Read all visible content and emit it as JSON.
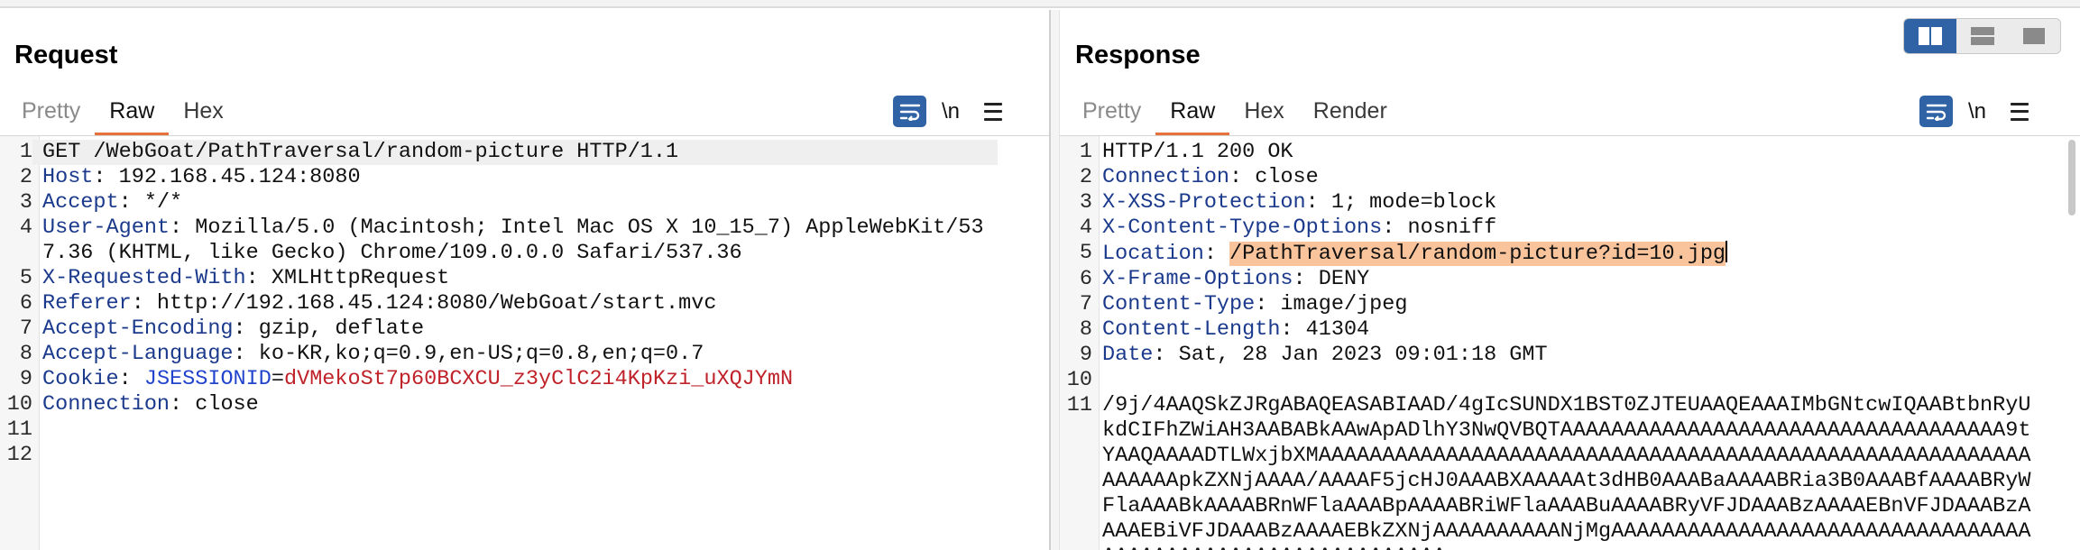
{
  "layout_toggle": {
    "options": [
      "side-by-side",
      "stacked-horizontal",
      "single-pane"
    ],
    "active": "side-by-side"
  },
  "request": {
    "title": "Request",
    "tabs": [
      {
        "label": "Pretty",
        "active": false
      },
      {
        "label": "Raw",
        "active": true
      },
      {
        "label": "Hex",
        "active": false
      }
    ],
    "newline_label": "\\n",
    "lines": [
      {
        "n": "1",
        "text": "GET /WebGoat/PathTraversal/random-picture HTTP/1.1"
      },
      {
        "n": "2",
        "key": "Host",
        "value": " 192.168.45.124:8080"
      },
      {
        "n": "3",
        "key": "Accept",
        "value": " */*"
      },
      {
        "n": "4",
        "key": "User-Agent",
        "value": " Mozilla/5.0 (Macintosh; Intel Mac OS X 10_15_7) AppleWebKit/537.36 (KHTML, like Gecko) Chrome/109.0.0.0 Safari/537.36"
      },
      {
        "n": "5",
        "key": "X-Requested-With",
        "value": " XMLHttpRequest"
      },
      {
        "n": "6",
        "key": "Referer",
        "value": " http://192.168.45.124:8080/WebGoat/start.mvc"
      },
      {
        "n": "7",
        "key": "Accept-Encoding",
        "value": " gzip, deflate"
      },
      {
        "n": "8",
        "key": "Accept-Language",
        "value": " ko-KR,ko;q=0.9,en-US;q=0.8,en;q=0.7"
      },
      {
        "n": "9",
        "key": "Cookie",
        "cookie_name": "JSESSIONID",
        "cookie_value": "dVMekoSt7p60BCXCU_z3yClC2i4KpKzi_uXQJYmN"
      },
      {
        "n": "10",
        "key": "Connection",
        "value": " close"
      },
      {
        "n": "11",
        "text": ""
      },
      {
        "n": "12",
        "text": ""
      }
    ]
  },
  "response": {
    "title": "Response",
    "tabs": [
      {
        "label": "Pretty",
        "active": false
      },
      {
        "label": "Raw",
        "active": true
      },
      {
        "label": "Hex",
        "active": false
      },
      {
        "label": "Render",
        "active": false
      }
    ],
    "newline_label": "\\n",
    "lines": [
      {
        "n": "1",
        "text": "HTTP/1.1 200 OK"
      },
      {
        "n": "2",
        "key": "Connection",
        "value": " close"
      },
      {
        "n": "3",
        "key": "X-XSS-Protection",
        "value": " 1; mode=block"
      },
      {
        "n": "4",
        "key": "X-Content-Type-Options",
        "value": " nosniff"
      },
      {
        "n": "5",
        "key": "Location",
        "value": " ",
        "selected": "/PathTraversal/random-picture?id=10.jpg"
      },
      {
        "n": "6",
        "key": "X-Frame-Options",
        "value": " DENY"
      },
      {
        "n": "7",
        "key": "Content-Type",
        "value": " image/jpeg"
      },
      {
        "n": "8",
        "key": "Content-Length",
        "value": " 41304"
      },
      {
        "n": "9",
        "key": "Date",
        "value": " Sat, 28 Jan 2023 09:01:18 GMT"
      },
      {
        "n": "10",
        "text": ""
      },
      {
        "n": "11",
        "text": "/9j/4AAQSkZJRgABAQEASABIAAD/4gIcSUNDX1BST0ZJTEUAAQEAAAIMbGNtcwIQAABtbnRyUkdCIFhZWiAH3AABABkAAwApADlhY3NwQVBQTAAAAAAAAAAAAAAAAAAAAAAAAAAAAAAAAAAA9tYAAQAAAADTLWxjbXMAAAAAAAAAAAAAAAAAAAAAAAAAAAAAAAAAAAAAAAAAAAAAAAAAAAAAAAAAAAAAApkZXNjAAAA/AAAAF5jcHJ0AAABXAAAAAt3dHB0AAABaAAAABRia3B0AAABfAAAABRyWFlaAAABkAAAABRnWFlaAAABpAAAABRiWFlaAAABuAAAABRyVFJDAAABzAAAAEBnVFJDAAABzAAAAEBiVFJDAAABzAAAAEBkZXNjAAAAAAAAAANjMgAAAAAAAAAAAAAAAAAAAAAAAAAAAAAAAAAAAAAAAAAAAAAAAAAAAAAAAAAAAA"
      }
    ]
  }
}
